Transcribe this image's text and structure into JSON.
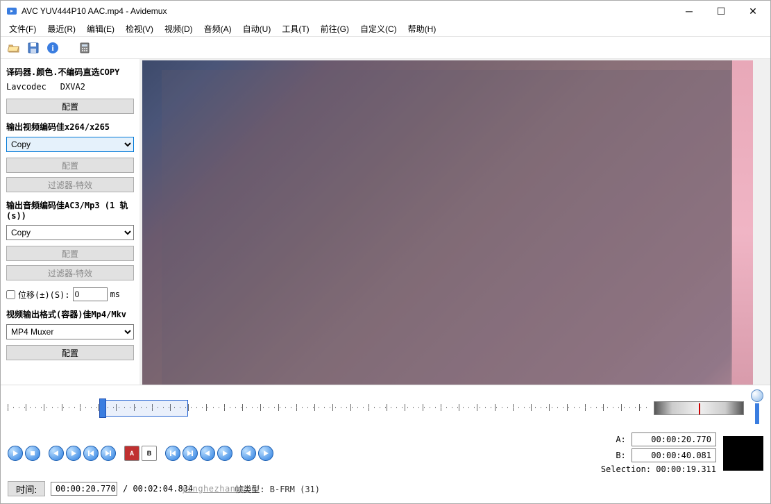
{
  "title": "AVC YUV444P10 AAC.mp4 - Avidemux",
  "menu": [
    "文件(F)",
    "最近(R)",
    "编辑(E)",
    "检视(V)",
    "视频(D)",
    "音频(A)",
    "自动(U)",
    "工具(T)",
    "前往(G)",
    "自定义(C)",
    "帮助(H)"
  ],
  "sidebar": {
    "decoder": {
      "title": "译码器.颜色.不编码直选COPY",
      "codec": "Lavcodec",
      "hw": "DXVA2",
      "configure": "配置"
    },
    "video_out": {
      "title": "输出视频编码佳x264/x265",
      "value": "Copy",
      "configure": "配置",
      "filters": "过滤器-特效"
    },
    "audio_out": {
      "title": "输出音频编码佳AC3/Mp3 (1 轨(s))",
      "value": "Copy",
      "configure": "配置",
      "filters": "过滤器-特效",
      "shift_label": "位移(±)(S):",
      "shift_value": "0",
      "shift_unit": "ms"
    },
    "format_out": {
      "title": "视频输出格式(容器)佳Mp4/Mkv",
      "value": "MP4 Muxer",
      "configure": "配置"
    }
  },
  "transport": {
    "buttons": [
      "play",
      "stop",
      "prev-frame",
      "next-frame",
      "prev-keyframe",
      "next-keyframe",
      "set-a",
      "set-b",
      "first",
      "last",
      "prev-cut",
      "next-cut",
      "prev-black",
      "next-black"
    ]
  },
  "markers": {
    "a_label": "A:",
    "a_value": "00:00:20.770",
    "b_label": "B:",
    "b_value": "00:00:40.081",
    "selection_label": "Selection:",
    "selection_value": "00:00:19.311"
  },
  "time": {
    "label": "时间:",
    "current": "00:00:20.770",
    "total": "/ 00:02:04.834",
    "frame_info": "帧类型: B-FRM (31)"
  },
  "watermark": "yinghezhan.com"
}
